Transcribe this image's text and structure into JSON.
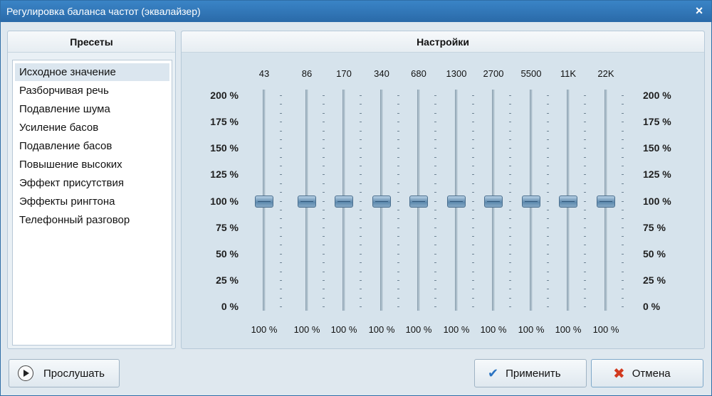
{
  "window": {
    "title": "Регулировка баланса частот (эквалайзер)",
    "close_glyph": "×"
  },
  "presets": {
    "header": "Пресеты",
    "items": [
      "Исходное значение",
      "Разборчивая речь",
      "Подавление шума",
      "Усиление басов",
      "Подавление басов",
      "Повышение высоких",
      "Эффект присутствия",
      "Эффекты рингтона",
      "Телефонный разговор"
    ],
    "selected_index": 0
  },
  "settings": {
    "header": "Настройки",
    "levels": [
      "200 %",
      "175 %",
      "150 %",
      "125 %",
      "100 %",
      "75 %",
      "50 %",
      "25 %",
      "0 %"
    ],
    "bands": [
      {
        "freq": "43",
        "value": "100 %",
        "level_percent": 100
      },
      {
        "freq": "86",
        "value": "100 %",
        "level_percent": 100
      },
      {
        "freq": "170",
        "value": "100 %",
        "level_percent": 100
      },
      {
        "freq": "340",
        "value": "100 %",
        "level_percent": 100
      },
      {
        "freq": "680",
        "value": "100 %",
        "level_percent": 100
      },
      {
        "freq": "1300",
        "value": "100 %",
        "level_percent": 100
      },
      {
        "freq": "2700",
        "value": "100 %",
        "level_percent": 100
      },
      {
        "freq": "5500",
        "value": "100 %",
        "level_percent": 100
      },
      {
        "freq": "11K",
        "value": "100 %",
        "level_percent": 100
      },
      {
        "freq": "22K",
        "value": "100 %",
        "level_percent": 100
      }
    ]
  },
  "buttons": {
    "listen": "Прослушать",
    "apply": "Применить",
    "cancel": "Отмена"
  },
  "icons": {
    "listen": "play-icon",
    "apply": "check-icon",
    "cancel": "x-icon"
  },
  "colors": {
    "titlebar": "#2f74b5",
    "cancel_icon": "#d23a1f",
    "apply_icon": "#2a73c2"
  }
}
